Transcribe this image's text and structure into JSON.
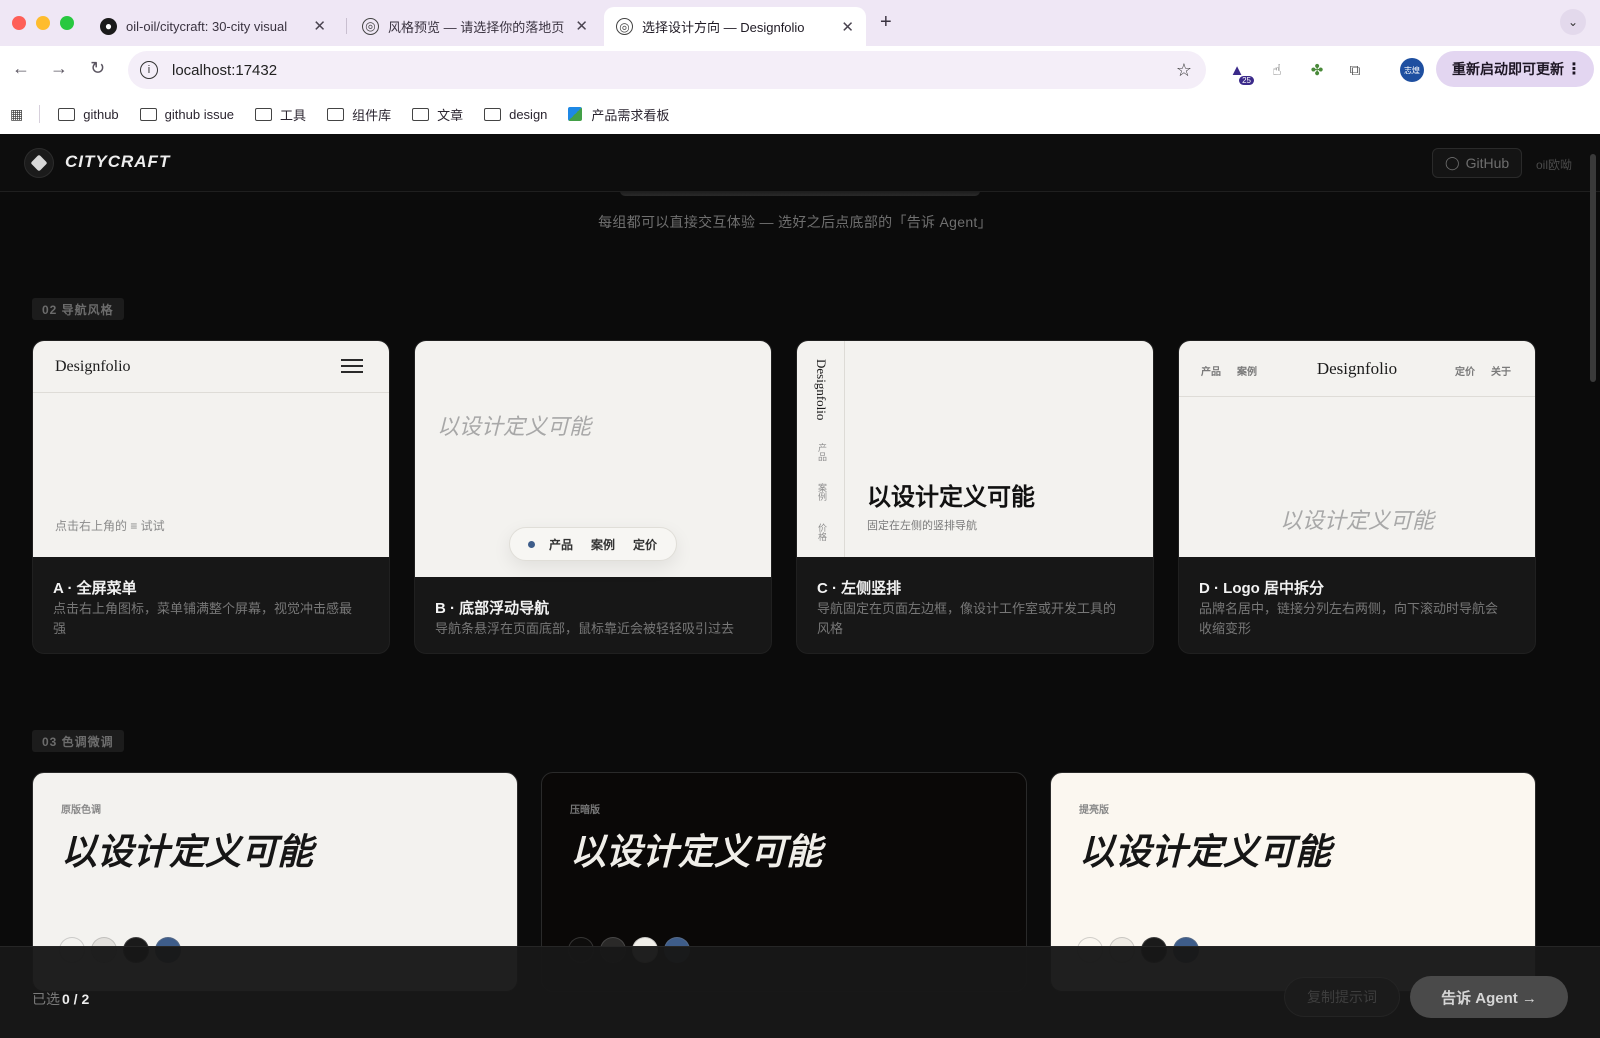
{
  "browser": {
    "tabs": [
      {
        "label": "oil-oil/citycraft: 30-city visual",
        "icon": "github-icon"
      },
      {
        "label": "风格预览 — 请选择你的落地页",
        "icon": "globe-icon"
      },
      {
        "label": "选择设计方向 — Designfolio",
        "icon": "globe-icon",
        "active": true
      }
    ],
    "url": "localhost:17432",
    "update_button": "重新启动即可更新",
    "extension_badge": "25",
    "profile_label": "志煌",
    "bookmarks": [
      "github",
      "github issue",
      "工具",
      "组件库",
      "文章",
      "design",
      "产品需求看板"
    ]
  },
  "site": {
    "logo": "CITYCRAFT",
    "github_label": "GitHub",
    "author": "oil欧呦"
  },
  "hero": {
    "subtitle": "每组都可以直接交互体验 — 选好之后点底部的「告诉 Agent」"
  },
  "nav_section": {
    "tag": "02  导航风格",
    "cards": [
      {
        "title": "A · 全屏菜单",
        "desc": "点击右上角图标，菜单铺满整个屏幕，视觉冲击感最强",
        "brand": "Designfolio",
        "hint": "点击右上角的 ≡ 试试"
      },
      {
        "title": "B · 底部浮动导航",
        "desc": "导航条悬浮在页面底部，鼠标靠近会被轻轻吸引过去",
        "slogan": "以设计定义可能",
        "pill_items": [
          "产品",
          "案例",
          "定价"
        ]
      },
      {
        "title": "C · 左侧竖排",
        "desc": "导航固定在页面左边框，像设计工作室或开发工具的风格",
        "brand": "Designfolio",
        "side_items": [
          "产品",
          "案例",
          "价格"
        ],
        "slogan": "以设计定义可能",
        "sub": "固定在左侧的竖排导航"
      },
      {
        "title": "D · Logo 居中拆分",
        "desc": "品牌名居中，链接分列左右两侧，向下滚动时导航会收缩变形",
        "brand": "Designfolio",
        "left_links": [
          "产品",
          "案例"
        ],
        "right_links": [
          "定价",
          "关于"
        ],
        "slogan": "以设计定义可能"
      }
    ]
  },
  "tone_section": {
    "tag": "03  色调微调",
    "cards": [
      {
        "label": "原版色调",
        "slogan": "以设计定义可能",
        "bg": "#f3f2ef",
        "fg": "#161616",
        "tag_color": "#8a8a8a",
        "swatches": [
          "#f3f2ef",
          "#e2e0dc",
          "#1a1a1a",
          "#3e5d8a"
        ]
      },
      {
        "label": "压暗版",
        "slogan": "以设计定义可能",
        "bg": "#0a0807",
        "fg": "#f0eee9",
        "tag_color": "#777777",
        "swatches": [
          "#0e0d0c",
          "#2a2928",
          "#f0eee9",
          "#3e5d8a"
        ]
      },
      {
        "label": "提亮版",
        "slogan": "以设计定义可能",
        "bg": "#fbf7f0",
        "fg": "#161616",
        "tag_color": "#8a8a8a",
        "swatches": [
          "#fbf7f0",
          "#efebe4",
          "#1a1a1a",
          "#3e5d8a"
        ]
      }
    ]
  },
  "bottom_bar": {
    "selected_prefix": "已选",
    "selected_count": "0 / 2",
    "copy_label": "复制提示词",
    "tell_label": "告诉 Agent →"
  }
}
